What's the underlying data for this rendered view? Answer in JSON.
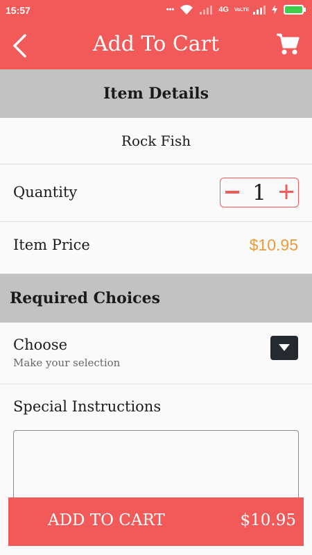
{
  "status_bar": {
    "time": "15:57",
    "network": "4G",
    "volte": "VoLTE"
  },
  "header": {
    "title": "Add To Cart"
  },
  "item_details": {
    "heading": "Item Details",
    "name": "Rock Fish",
    "quantity_label": "Quantity",
    "quantity_value": "1",
    "price_label": "Item Price",
    "price_value": "$10.95"
  },
  "required_choices": {
    "heading": "Required Choices",
    "choose_label": "Choose",
    "choose_placeholder": "Make your selection"
  },
  "special": {
    "label": "Special Instructions",
    "value": ""
  },
  "footer": {
    "add_label": "ADD TO CART",
    "total": "$10.95"
  },
  "colors": {
    "primary": "#f25a5a",
    "section_bg": "#c2c2c2",
    "price": "#ef9a38",
    "dropdown_bg": "#252a30"
  }
}
